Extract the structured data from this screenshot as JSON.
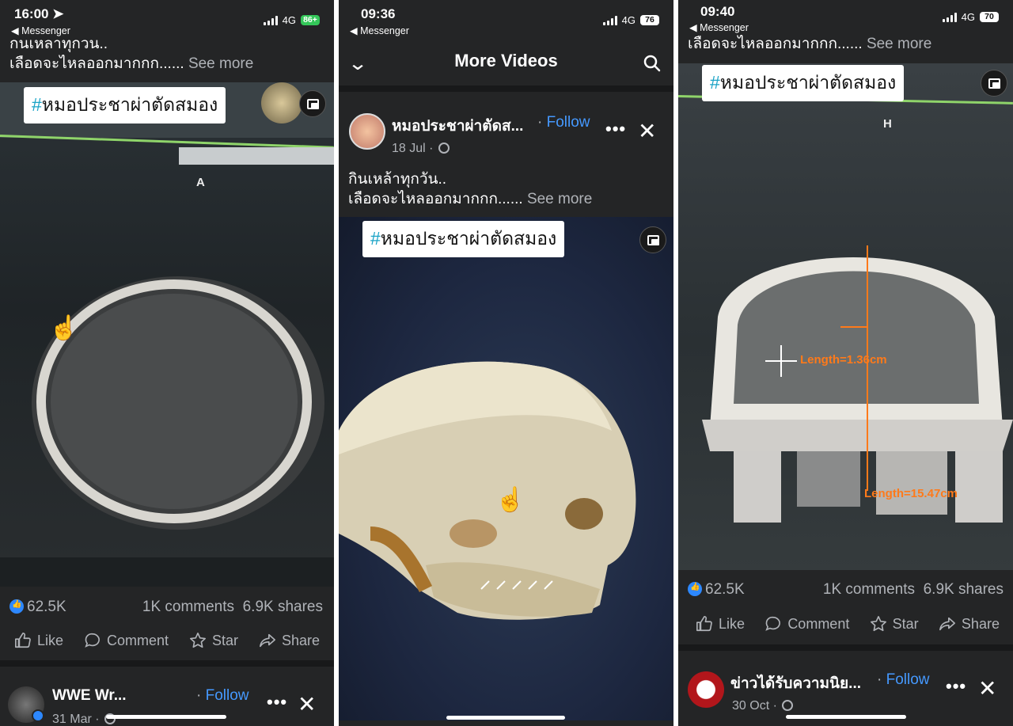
{
  "panel1": {
    "status": {
      "time": "16:00",
      "back": "◀ Messenger",
      "network": "4G",
      "battery": "86+"
    },
    "caption_line1": "กนเหลาทุกวน..",
    "caption_line2": "เลือดจะไหลออกมากกก......",
    "see_more": "See more",
    "tag_hash": "#",
    "tag_text": "หมอประชาผ่าตัดสมอง",
    "scan_letter": "A",
    "reactions": "62.5K",
    "comments": "1K comments",
    "shares": "6.9K shares",
    "actions": {
      "like": "Like",
      "comment": "Comment",
      "star": "Star",
      "share": "Share"
    },
    "next_post": {
      "name": "WWE Wr...",
      "follow": "Follow",
      "date": "31 Mar"
    }
  },
  "panel2": {
    "status": {
      "time": "09:36",
      "back": "◀ Messenger",
      "network": "4G",
      "battery": "76"
    },
    "header_title": "More Videos",
    "post": {
      "name": "หมอประชาผ่าตัดส...",
      "follow": "Follow",
      "date": "18 Jul"
    },
    "caption_line1": "กินเหล้าทุกวัน..",
    "caption_line2": "เลือดจะไหลออกมากกก......",
    "see_more": "See more",
    "tag_hash": "#",
    "tag_text": "หมอประชาผ่าตัดสมอง"
  },
  "panel3": {
    "status": {
      "time": "09:40",
      "back": "◀ Messenger",
      "network": "4G",
      "battery": "70"
    },
    "caption_line2": "เลือดจะไหลออกมากกก......",
    "see_more": "See more",
    "tag_hash": "#",
    "tag_text": "หมอประชาผ่าตัดสมอง",
    "scan_letter": "H",
    "measure1": "Length=1.36cm",
    "measure2": "Length=15.47cm",
    "reactions": "62.5K",
    "comments": "1K comments",
    "shares": "6.9K shares",
    "actions": {
      "like": "Like",
      "comment": "Comment",
      "star": "Star",
      "share": "Share"
    },
    "next_post": {
      "name": "ข่าวได้รับความนิย...",
      "follow": "Follow",
      "date": "30 Oct"
    }
  },
  "colors": {
    "bg": "#242526",
    "link": "#4599ff",
    "muted": "#b0b3b8",
    "accent_orange": "#ff7a1a"
  },
  "icons": [
    "location-arrow-icon",
    "signal-icon",
    "battery-icon",
    "chevron-down-icon",
    "search-icon",
    "pip-icon",
    "like-icon",
    "comment-icon",
    "star-icon",
    "share-icon",
    "globe-icon",
    "more-icon",
    "close-icon",
    "hand-cursor-icon"
  ]
}
